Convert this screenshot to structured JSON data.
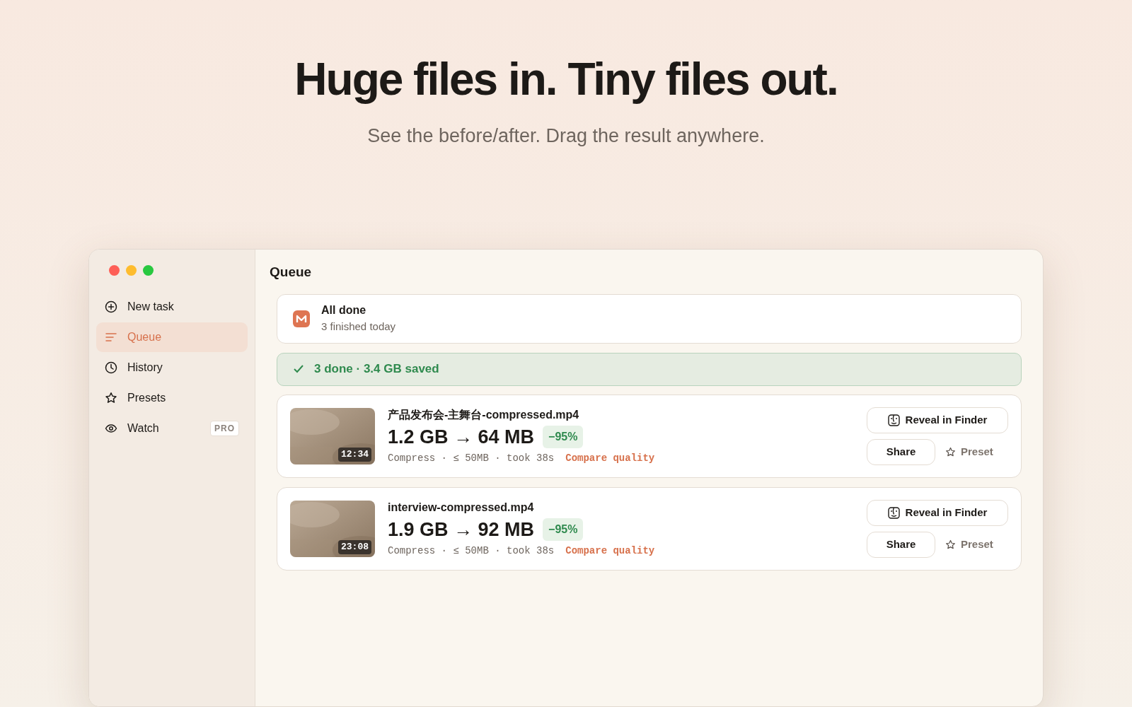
{
  "hero": {
    "title": "Huge files in. Tiny files out.",
    "subtitle": "See the before/after. Drag the result anywhere."
  },
  "sidebar": {
    "items": [
      {
        "label": "New task",
        "selected": false
      },
      {
        "label": "Queue",
        "selected": true
      },
      {
        "label": "History",
        "selected": false
      },
      {
        "label": "Presets",
        "selected": false
      },
      {
        "label": "Watch",
        "selected": false,
        "badge": "PRO"
      }
    ]
  },
  "main": {
    "title": "Queue",
    "status_card": {
      "title": "All done",
      "subtitle": "3 finished today"
    },
    "summary": "3 done · 3.4 GB saved",
    "files": [
      {
        "name": "产品发布会-主舞台-compressed.mp4",
        "duration": "12:34",
        "sizes": "1.2 GB → 64 MB",
        "reduction": "−95%",
        "details": "Compress · ≤ 50MB · took 38s",
        "compare": "Compare quality",
        "reveal": "Reveal in Finder",
        "share": "Share",
        "preset": "Preset"
      },
      {
        "name": "interview-compressed.mp4",
        "duration": "23:08",
        "sizes": "1.9 GB → 92 MB",
        "reduction": "−95%",
        "details": "Compress · ≤ 50MB · took 38s",
        "compare": "Compare quality",
        "reveal": "Reveal in Finder",
        "share": "Share",
        "preset": "Preset"
      }
    ]
  }
}
